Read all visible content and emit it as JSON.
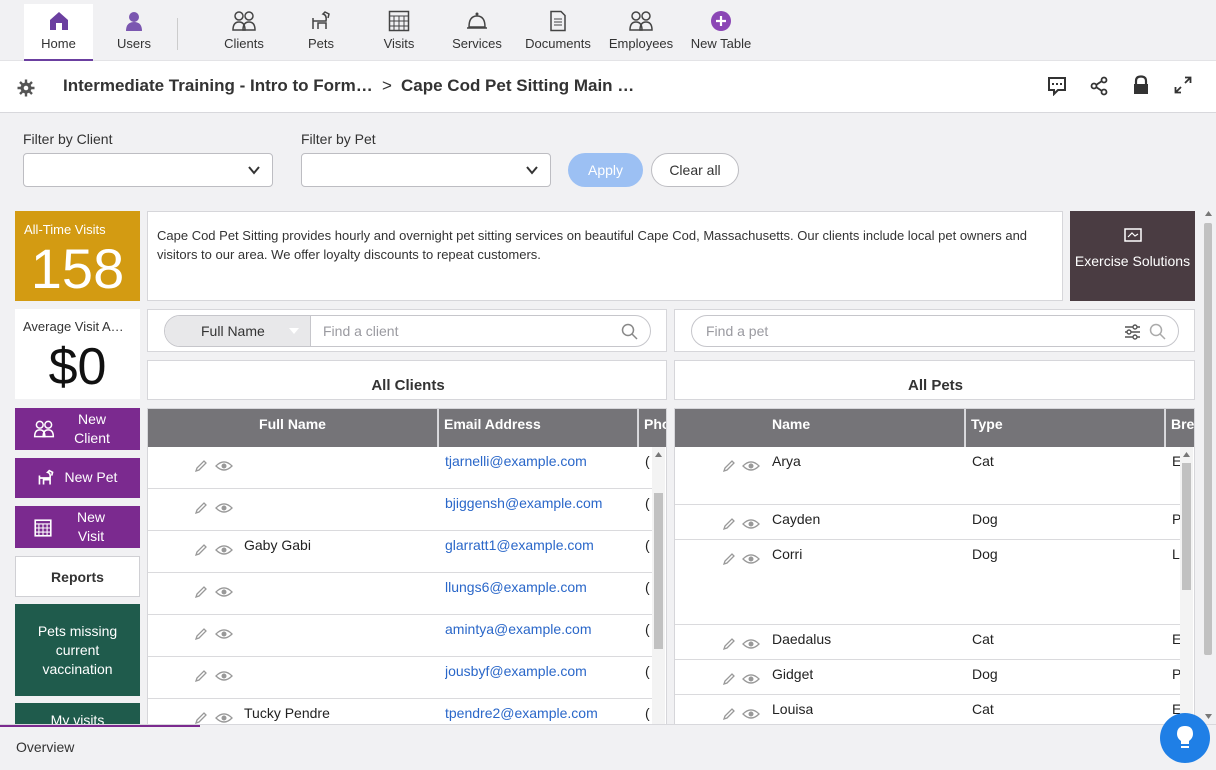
{
  "nav": {
    "items": [
      {
        "label": "Home",
        "icon": "home-icon",
        "active": true
      },
      {
        "label": "Users",
        "icon": "user-icon"
      },
      {
        "label": "Clients",
        "icon": "clients-icon"
      },
      {
        "label": "Pets",
        "icon": "pet-icon"
      },
      {
        "label": "Visits",
        "icon": "calendar-grid-icon"
      },
      {
        "label": "Services",
        "icon": "bell-icon"
      },
      {
        "label": "Documents",
        "icon": "document-icon"
      },
      {
        "label": "Employees",
        "icon": "employees-icon"
      },
      {
        "label": "New Table",
        "icon": "plus-circle-icon"
      }
    ]
  },
  "breadcrumb": {
    "part1": "Intermediate Training - Intro to Form…",
    "separator": ">",
    "part2": "Cape Cod Pet Sitting Main …"
  },
  "filters": {
    "client_label": "Filter by Client",
    "client_value": "",
    "pet_label": "Filter by Pet",
    "pet_value": "",
    "apply_label": "Apply",
    "clear_label": "Clear all"
  },
  "stats": {
    "visits_label": "All-Time Visits",
    "visits_value": "158",
    "avg_label": "Average Visit A…",
    "avg_value": "$0"
  },
  "actions": {
    "new_client": "New Client",
    "new_pet": "New Pet",
    "new_visit": "New Visit",
    "reports": "Reports",
    "pets_missing": "Pets missing current vaccination",
    "my_visits": "My visits"
  },
  "description": "Cape Cod Pet Sitting provides hourly and overnight pet sitting services on beautiful Cape Cod, Massachusetts.  Our clients include local pet owners and visitors to our area. We offer loyalty discounts to repeat customers.",
  "exercise": "Exercise Solutions",
  "clients": {
    "search_field": "Full Name",
    "search_placeholder": "Find a client",
    "title": "All Clients",
    "columns": [
      "Full Name",
      "Email Address",
      "Pho"
    ],
    "rows": [
      {
        "name": "",
        "email": "tjarnelli@example.com",
        "phone": "("
      },
      {
        "name": "",
        "email": "bjiggensh@example.com",
        "phone": "("
      },
      {
        "name": "Gaby Gabi",
        "email": "glarratt1@example.com",
        "phone": "("
      },
      {
        "name": "",
        "email": "llungs6@example.com",
        "phone": "("
      },
      {
        "name": "",
        "email": "amintya@example.com",
        "phone": "("
      },
      {
        "name": "",
        "email": "jousbyf@example.com",
        "phone": "("
      },
      {
        "name": "Tucky Pendre",
        "email": "tpendre2@example.com",
        "phone": "("
      }
    ]
  },
  "pets": {
    "search_placeholder": "Find a pet",
    "title": "All Pets",
    "columns": [
      "Name",
      "Type",
      "Bre"
    ],
    "rows": [
      {
        "name": "Arya",
        "type": "Cat",
        "breed": "E"
      },
      {
        "name": "Cayden",
        "type": "Dog",
        "breed": "P"
      },
      {
        "name": "Corri",
        "type": "Dog",
        "breed": "L"
      },
      {
        "name": "Daedalus",
        "type": "Cat",
        "breed": "E"
      },
      {
        "name": "Gidget",
        "type": "Dog",
        "breed": "P"
      },
      {
        "name": "Louisa",
        "type": "Cat",
        "breed": "E"
      }
    ]
  },
  "bottom": {
    "tab": "Overview"
  },
  "colors": {
    "purple": "#7b2a8f",
    "gold": "#d39b12",
    "green": "#1f5b4c",
    "link": "#2a67c9"
  }
}
